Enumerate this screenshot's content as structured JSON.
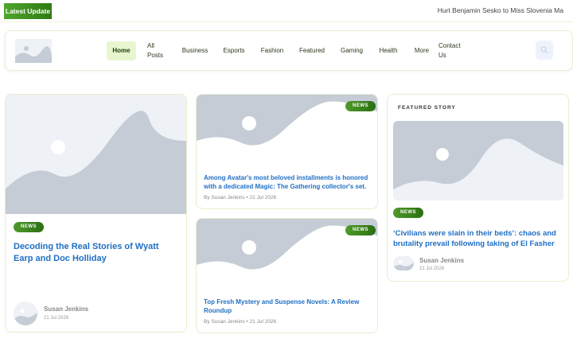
{
  "ticker": {
    "label": "Latest Update",
    "headline": "Hurt Benjamin Sesko to Miss Slovenia Ma"
  },
  "nav": {
    "items": [
      {
        "label": "Home",
        "active": true
      },
      {
        "label": "All Posts"
      },
      {
        "label": "Business"
      },
      {
        "label": "Esports"
      },
      {
        "label": "Fashion"
      },
      {
        "label": "Featured"
      },
      {
        "label": "Gaming"
      },
      {
        "label": "Health"
      },
      {
        "label": "More"
      },
      {
        "label": "Contact Us"
      }
    ],
    "search_icon": "search-icon"
  },
  "main_post": {
    "badge": "NEWS",
    "title": "Decoding the Real Stories of Wyatt Earp and Doc Holliday",
    "author": "Susan Jenkins",
    "date": "21 Jul 2026"
  },
  "mid_posts": [
    {
      "badge": "NEWS",
      "title": "Among Avatar's most beloved installments is honored with a dedicated Magic: The Gathering collector's set.",
      "meta": "By Susan Jenkins  •  21 Jul 2026"
    },
    {
      "badge": "NEWS",
      "title": "Top Fresh Mystery and Suspense Novels: A Review Roundup",
      "meta": "By Susan Jenkins  •  21 Jul 2026"
    }
  ],
  "featured": {
    "section_label": "FEATURED STORY",
    "badge": "NEWS",
    "title": "‘Civilians were slain in their beds’: chaos and brutality prevail following taking of El Fasher",
    "author": "Susan Jenkins",
    "date": "21 Jul 2026"
  },
  "colors": {
    "accent": "#3f8f1f",
    "title_blue": "#1f6fc4",
    "border": "#e6efcd"
  }
}
